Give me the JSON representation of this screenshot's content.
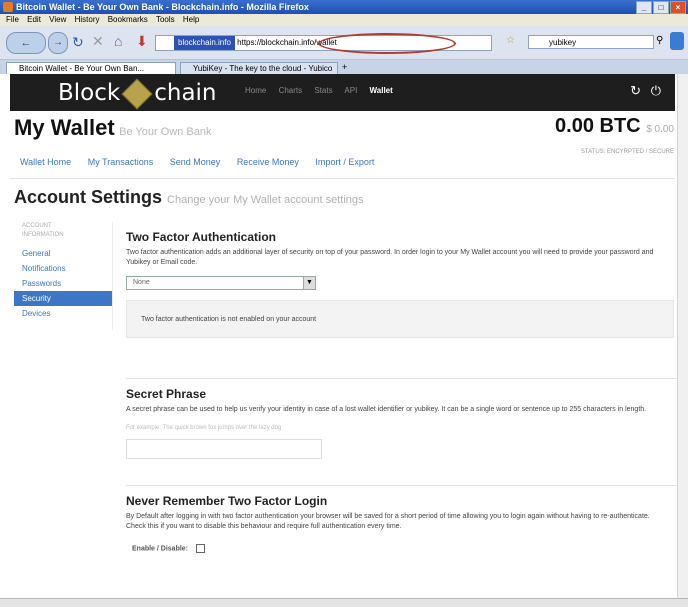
{
  "browser": {
    "title": "Bitcoin Wallet - Be Your Own Bank - Blockchain.info - Mozilla Firefox",
    "menu": [
      "File",
      "Edit",
      "View",
      "History",
      "Bookmarks",
      "Tools",
      "Help"
    ],
    "url_highlight": "blockchain.info",
    "url": "https://blockchain.info/wallet",
    "search_value": "yubikey",
    "tabs": [
      {
        "label": "Bitcoin Wallet - Be Your Own Ban...",
        "active": true
      },
      {
        "label": "YubiKey - The key to the cloud - Yubico",
        "active": false
      }
    ]
  },
  "site": {
    "logo_left": "Block",
    "logo_right": "chain",
    "nav": [
      "Home",
      "Charts",
      "Stats",
      "API",
      "Wallet"
    ],
    "nav_active": "Wallet",
    "icons": [
      "refresh-icon",
      "power-icon"
    ]
  },
  "wallet": {
    "title": "My Wallet",
    "subtitle": "Be Your Own Bank",
    "balance": "0.00 BTC",
    "usd": "$ 0.00",
    "status": "STATUS: ENCYRPTED / SECURE",
    "nav": [
      "Wallet Home",
      "My Transactions",
      "Send Money",
      "Receive Money",
      "Import / Export"
    ]
  },
  "settings": {
    "title": "Account Settings",
    "subtitle": "Change your My Wallet account settings",
    "sidebar_header": [
      "ACCOUNT",
      "INFORMATION"
    ],
    "sidebar_items": [
      "General",
      "Notifications",
      "Passwords",
      "Security",
      "Devices"
    ],
    "sidebar_active": "Security",
    "two_factor": {
      "title": "Two Factor Authentication",
      "desc": "Two factor authentication adds an additional layer of security on top of your password. In order login to your My Wallet account you will need to provide your password and Yubikey or Email code.",
      "select_value": "None",
      "notice": "Two factor authentication is not enabled on your account"
    },
    "secret_phrase": {
      "title": "Secret Phrase",
      "desc": "A secret phrase can be used to help us verify your identity in case of a lost wallet identifier or yubikey. It can be a single word or sentence up to 255 characters in length.",
      "hint": "For example: The quick brown fox jumps over the lazy dog"
    },
    "never_remember": {
      "title": "Never Remember Two Factor Login",
      "desc": "By Default after logging in with two factor authentication your browser will be saved for a short period of time allowing you to login again without having to re-authenticate. Check this if you want to disable this behaviour and require full authentication every time.",
      "checkbox_label": "Enable / Disable:"
    }
  },
  "colors": {
    "accent": "#3c76c4",
    "topbar": "#1e1e1e",
    "highlight_oval": "#b03a2e"
  }
}
